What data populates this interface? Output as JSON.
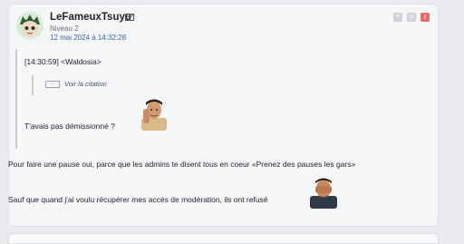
{
  "post": {
    "username": "LeFameuxTsuyu",
    "level": "Niveau 2",
    "date": "12 mai 2024 à 14:32:28"
  },
  "quote": {
    "timestamp_author": "[14:30:59] <Waldosia>",
    "see_quote": "Voir la citation",
    "ellipsis": "···",
    "text": "T'avais pas démissionné ?"
  },
  "messages": [
    "Pour faire une pause oui, parce que les admins te disent tous en coeur «Prenez des pauses les gars»",
    "Sauf que quand j'ai voulu récupérer mes accès de modération, ils ont refusé"
  ],
  "icons": {
    "mail": "mail-icon",
    "quote_action": "quote-icon",
    "mp_action": "message-icon",
    "alert_action": "alert-icon"
  },
  "colors": {
    "username": "#1f2329",
    "date_link": "#3a66c4",
    "alert": "#e86b6b"
  }
}
